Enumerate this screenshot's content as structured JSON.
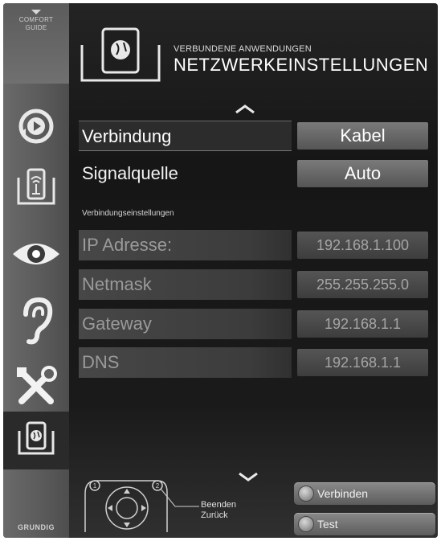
{
  "sidebar": {
    "comfort_line1": "COMFORT",
    "comfort_line2": "GUIDE",
    "items": [
      {
        "icon": "source-icon"
      },
      {
        "icon": "network-app-icon"
      },
      {
        "icon": "picture-eye-icon"
      },
      {
        "icon": "sound-ear-icon"
      },
      {
        "icon": "settings-tools-icon"
      },
      {
        "icon": "network-settings-icon",
        "active": true
      }
    ],
    "brand": "GRUNDIG"
  },
  "header": {
    "subtitle": "VERBUNDENE ANWENDUNGEN",
    "title": "NETZWERKEINSTELLUNGEN"
  },
  "settings": {
    "connection": {
      "label": "Verbindung",
      "value": "Kabel"
    },
    "signal_source": {
      "label": "Signalquelle",
      "value": "Auto"
    },
    "section_label": "Verbindungseinstellungen",
    "ip": {
      "label": "IP Adresse:",
      "value": "192.168.1.100"
    },
    "netmask": {
      "label": "Netmask",
      "value": "255.255.255.0"
    },
    "gateway": {
      "label": "Gateway",
      "value": "192.168.1.1"
    },
    "dns": {
      "label": "DNS",
      "value": "192.168.1.1"
    }
  },
  "footer": {
    "key1": "1",
    "key2": "2",
    "exit_label": "Beenden",
    "back_label": "Zurück",
    "connect_button": "Verbinden",
    "test_button": "Test"
  }
}
